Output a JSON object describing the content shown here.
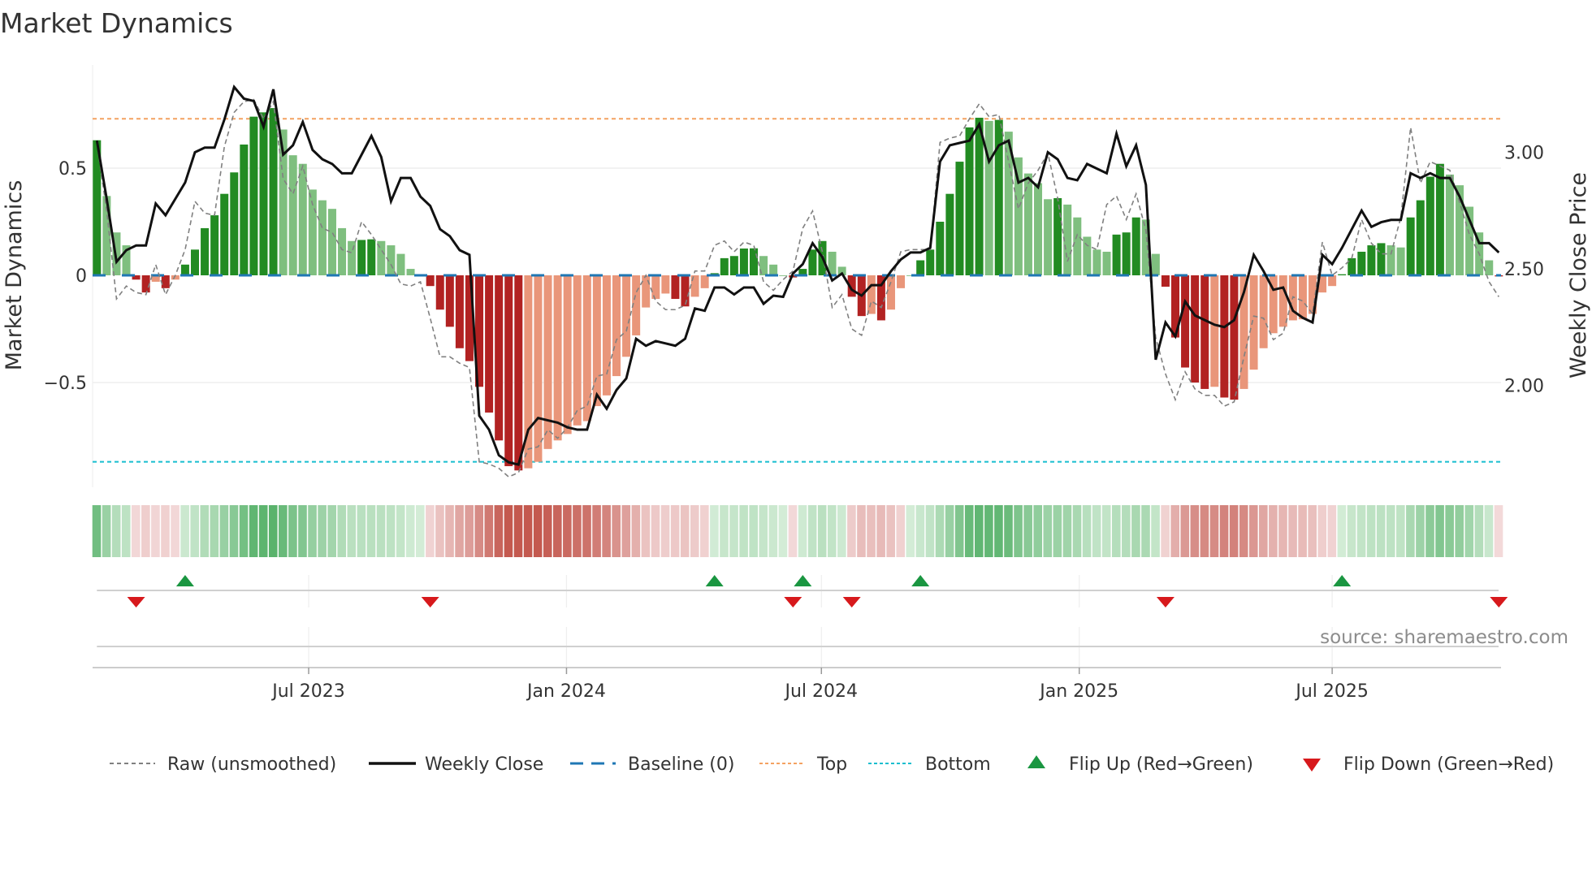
{
  "chart_data": {
    "type": "bar",
    "title": "Market Dynamics",
    "ylabel": "Market Dynamics",
    "y2label": "Weekly Close Price",
    "ylim": [
      -0.98,
      1.0
    ],
    "y2lim": [
      1.59,
      3.44
    ],
    "yticks": [
      {
        "value": 0.5,
        "label": "0.5"
      },
      {
        "value": 0,
        "label": "0"
      },
      {
        "value": -0.5,
        "label": "−0.5"
      }
    ],
    "y2ticks": [
      {
        "value": 3.0,
        "label": "3.00"
      },
      {
        "value": 2.5,
        "label": "2.50"
      },
      {
        "value": 2.0,
        "label": "2.00"
      }
    ],
    "xticks": [
      {
        "week": 21.6,
        "label": "Jul 2023"
      },
      {
        "week": 47.9,
        "label": "Jan 2024"
      },
      {
        "week": 73.9,
        "label": "Jul 2024"
      },
      {
        "week": 100.2,
        "label": "Jan 2025"
      },
      {
        "week": 126.0,
        "label": "Jul 2025"
      }
    ],
    "baseline": 0,
    "top": 0.73,
    "bottom": -0.87,
    "grid": true,
    "dynamics": [
      0.63,
      0.37,
      0.2,
      0.14,
      -0.02,
      -0.08,
      -0.03,
      -0.06,
      -0.02,
      0.05,
      0.12,
      0.22,
      0.28,
      0.38,
      0.48,
      0.61,
      0.74,
      0.76,
      0.78,
      0.68,
      0.56,
      0.52,
      0.4,
      0.35,
      0.31,
      0.22,
      0.16,
      0.165,
      0.168,
      0.16,
      0.14,
      0.1,
      0.03,
      0,
      -0.05,
      -0.16,
      -0.24,
      -0.34,
      -0.4,
      -0.52,
      -0.64,
      -0.77,
      -0.89,
      -0.91,
      -0.9,
      -0.87,
      -0.81,
      -0.77,
      -0.74,
      -0.7,
      -0.68,
      -0.61,
      -0.56,
      -0.47,
      -0.38,
      -0.28,
      -0.15,
      -0.11,
      -0.085,
      -0.11,
      -0.145,
      -0.1,
      -0.06,
      0.01,
      0.08,
      0.09,
      0.125,
      0.126,
      0.09,
      0.05,
      0,
      -0.01,
      0.03,
      0.12,
      0.16,
      0.11,
      0.04,
      -0.1,
      -0.19,
      -0.18,
      -0.21,
      -0.16,
      -0.06,
      0,
      0.07,
      0.12,
      0.25,
      0.38,
      0.53,
      0.69,
      0.735,
      0.72,
      0.725,
      0.67,
      0.55,
      0.475,
      0.43,
      0.355,
      0.36,
      0.33,
      0.27,
      0.18,
      0.12,
      0.11,
      0.19,
      0.2,
      0.27,
      0.26,
      0.1,
      -0.053,
      -0.29,
      -0.43,
      -0.5,
      -0.53,
      -0.52,
      -0.57,
      -0.58,
      -0.53,
      -0.44,
      -0.34,
      -0.27,
      -0.24,
      -0.21,
      -0.205,
      -0.18,
      -0.08,
      -0.05,
      0.005,
      0.08,
      0.11,
      0.14,
      0.15,
      0.14,
      0.13,
      0.27,
      0.35,
      0.46,
      0.52,
      0.47,
      0.42,
      0.32,
      0.2,
      0.07,
      -0.005
    ],
    "raw": [
      0.62,
      0.3,
      -0.11,
      -0.05,
      -0.08,
      -0.09,
      0.05,
      -0.09,
      0.0,
      0.12,
      0.345,
      0.29,
      0.28,
      0.6,
      0.76,
      0.81,
      0.82,
      0.73,
      0.81,
      0.45,
      0.38,
      0.51,
      0.33,
      0.22,
      0.2,
      0.12,
      0.105,
      0.25,
      0.19,
      0.12,
      0.05,
      -0.04,
      -0.05,
      -0.03,
      -0.2,
      -0.38,
      -0.38,
      -0.41,
      -0.43,
      -0.87,
      -0.88,
      -0.9,
      -0.94,
      -0.92,
      -0.81,
      -0.8,
      -0.72,
      -0.76,
      -0.71,
      -0.63,
      -0.61,
      -0.47,
      -0.46,
      -0.3,
      -0.26,
      -0.08,
      0.0,
      -0.12,
      -0.16,
      -0.16,
      -0.14,
      0.02,
      0.02,
      0.14,
      0.16,
      0.11,
      0.155,
      0.14,
      -0.03,
      -0.07,
      -0.02,
      0.02,
      0.22,
      0.3,
      0.11,
      -0.15,
      -0.09,
      -0.25,
      -0.28,
      -0.12,
      -0.15,
      -0.03,
      0.11,
      0.12,
      0.12,
      0.12,
      0.62,
      0.64,
      0.65,
      0.73,
      0.8,
      0.74,
      0.75,
      0.53,
      0.31,
      0.43,
      0.49,
      0.57,
      0.36,
      0.065,
      0.19,
      0.14,
      0.12,
      0.33,
      0.37,
      0.26,
      0.38,
      0.21,
      -0.29,
      -0.46,
      -0.58,
      -0.45,
      -0.53,
      -0.56,
      -0.56,
      -0.61,
      -0.59,
      -0.38,
      -0.19,
      -0.2,
      -0.3,
      -0.27,
      -0.1,
      -0.12,
      -0.18,
      0.155,
      0.0,
      0.035,
      0.08,
      0.26,
      0.15,
      0.1,
      0.1,
      0.27,
      0.69,
      0.43,
      0.53,
      0.51,
      0.49,
      0.34,
      0.19,
      0.1,
      -0.03,
      -0.1
    ],
    "weekly_close": [
      3.05,
      2.8,
      2.53,
      2.58,
      2.6,
      2.6,
      2.78,
      2.73,
      2.8,
      2.87,
      3.0,
      3.02,
      3.02,
      3.14,
      3.28,
      3.23,
      3.22,
      3.11,
      3.27,
      2.99,
      3.03,
      3.13,
      3.01,
      2.97,
      2.95,
      2.91,
      2.91,
      2.99,
      3.07,
      2.98,
      2.79,
      2.89,
      2.89,
      2.81,
      2.77,
      2.67,
      2.64,
      2.58,
      2.56,
      1.87,
      1.81,
      1.7,
      1.67,
      1.66,
      1.81,
      1.86,
      1.85,
      1.84,
      1.82,
      1.81,
      1.81,
      1.96,
      1.9,
      1.98,
      2.03,
      2.2,
      2.17,
      2.19,
      2.18,
      2.17,
      2.2,
      2.33,
      2.32,
      2.42,
      2.42,
      2.39,
      2.42,
      2.42,
      2.35,
      2.385,
      2.38,
      2.48,
      2.52,
      2.61,
      2.55,
      2.45,
      2.48,
      2.41,
      2.385,
      2.43,
      2.43,
      2.49,
      2.54,
      2.57,
      2.57,
      2.59,
      2.96,
      3.03,
      3.04,
      3.05,
      3.12,
      2.96,
      3.03,
      3.05,
      2.87,
      2.89,
      2.85,
      3.0,
      2.97,
      2.89,
      2.88,
      2.95,
      2.93,
      2.91,
      3.08,
      2.94,
      3.03,
      2.86,
      2.11,
      2.27,
      2.21,
      2.36,
      2.3,
      2.28,
      2.26,
      2.25,
      2.28,
      2.4,
      2.56,
      2.49,
      2.41,
      2.42,
      2.32,
      2.29,
      2.27,
      2.56,
      2.52,
      2.59,
      2.67,
      2.75,
      2.68,
      2.7,
      2.71,
      2.71,
      2.91,
      2.89,
      2.91,
      2.89,
      2.89,
      2.81,
      2.71,
      2.61,
      2.61,
      2.57
    ],
    "flip_up_weeks": [
      9,
      63,
      72,
      84,
      127
    ],
    "flip_down_weeks": [
      4,
      34,
      71,
      77,
      109,
      143
    ],
    "legend_position": "bottom",
    "legend": [
      "Raw (unsmoothed)",
      "Weekly Close",
      "Baseline (0)",
      "Top",
      "Bottom",
      "Flip Up (Red→Green)",
      "Flip Down (Green→Red)"
    ],
    "source": "source: sharemaestro.com"
  },
  "colors": {
    "up_strong": "#228b22",
    "up_weak": "#7fbf7f",
    "down_strong": "#b22222",
    "down_weak": "#e9967a",
    "close": "#111111",
    "raw": "#808080",
    "baseline": "#1f77b4",
    "top": "#f4a261",
    "bottom": "#17becf",
    "flip_up": "#1a9641",
    "flip_down": "#d7191c"
  }
}
